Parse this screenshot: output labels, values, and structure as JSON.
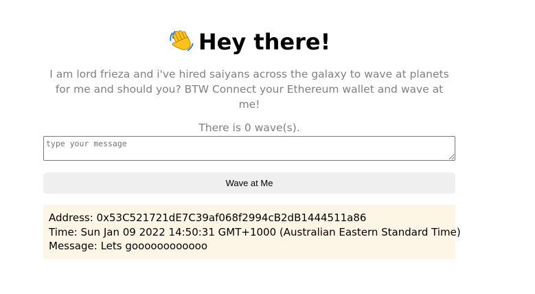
{
  "header": {
    "emoji_icon": "waving-hand-icon",
    "title": "Hey there!"
  },
  "bio": {
    "text": "I am lord frieza and i've hired saiyans across the galaxy to wave at planets for me and should you? BTW Connect your Ethereum wallet and wave at me!"
  },
  "wave_count": {
    "text": "There is 0 wave(s)."
  },
  "message_input": {
    "placeholder": "type your message",
    "value": ""
  },
  "wave_button": {
    "label": "Wave at Me"
  },
  "waves": [
    {
      "address_label": "Address: 0x53C521721dE7C39af068f2994cB2dB1444511a86",
      "time_label": "Time: Sun Jan 09 2022 14:50:31 GMT+1000 (Australian Eastern Standard Time)",
      "message_label": "Message: Lets goooooooooooo"
    }
  ],
  "colors": {
    "muted_text": "#808080",
    "button_bg": "#efefef",
    "card_bg": "#fdf5e6"
  }
}
